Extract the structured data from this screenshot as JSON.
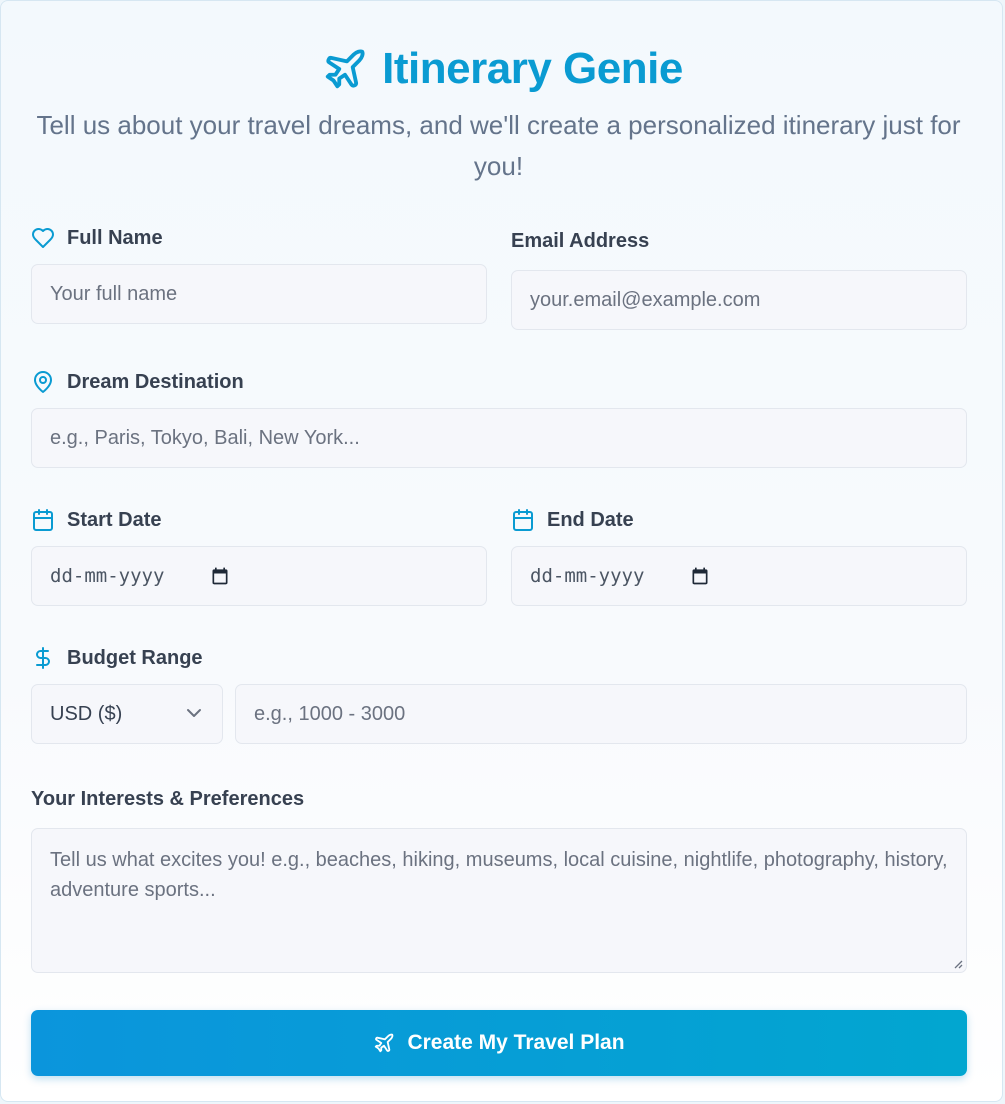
{
  "header": {
    "title": "Itinerary Genie",
    "subtitle": "Tell us about your travel dreams, and we'll create a personalized itinerary just for you!"
  },
  "form": {
    "full_name": {
      "label": "Full Name",
      "placeholder": "Your full name"
    },
    "email": {
      "label": "Email Address",
      "placeholder": "your.email@example.com"
    },
    "destination": {
      "label": "Dream Destination",
      "placeholder": "e.g., Paris, Tokyo, Bali, New York..."
    },
    "start_date": {
      "label": "Start Date",
      "placeholder": "dd-mm-yyyy"
    },
    "end_date": {
      "label": "End Date",
      "placeholder": "dd-mm-yyyy"
    },
    "budget": {
      "label": "Budget Range",
      "currency_selected": "USD ($)",
      "placeholder": "e.g., 1000 - 3000"
    },
    "interests": {
      "label": "Your Interests & Preferences",
      "placeholder": "Tell us what excites you! e.g., beaches, hiking, museums, local cuisine, nightlife, photography, history, adventure sports..."
    },
    "submit_label": "Create My Travel Plan"
  },
  "theme": {
    "accent": "#0a9bd2",
    "button_gradient": [
      "#0b95dc",
      "#02a6d0"
    ],
    "text": "#374151",
    "muted": "#64748b"
  },
  "icons": {
    "title": "plane-icon",
    "full_name": "heart-icon",
    "destination": "map-pin-icon",
    "dates": "calendar-icon",
    "budget": "dollar-icon",
    "submit": "plane-icon"
  }
}
